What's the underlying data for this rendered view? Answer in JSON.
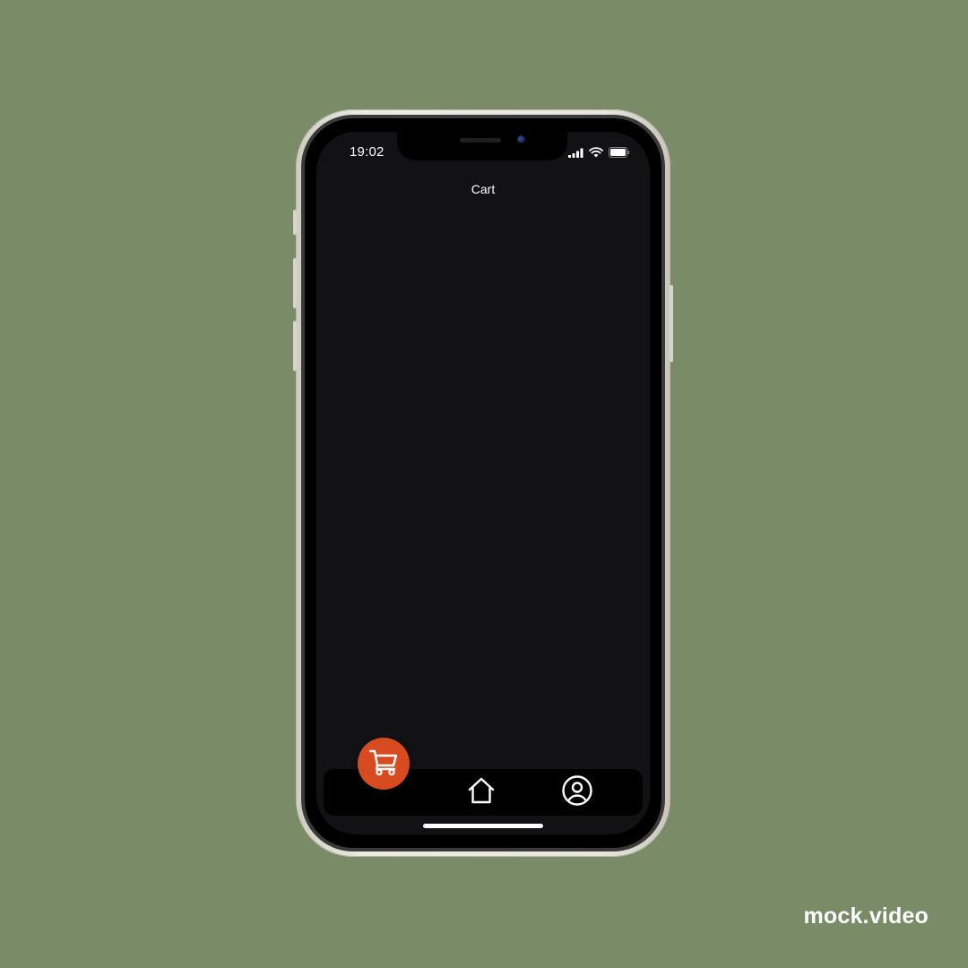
{
  "status_bar": {
    "time": "19:02",
    "icons": [
      "cellular-signal-icon",
      "wifi-icon",
      "battery-icon"
    ]
  },
  "screen": {
    "title": "Cart"
  },
  "cart_button": {
    "icon": "cart-icon",
    "color": "#d84b20"
  },
  "bottom_nav": {
    "items": [
      {
        "icon": "home-icon"
      },
      {
        "icon": "profile-icon"
      }
    ]
  },
  "watermark": "mock.video",
  "colors": {
    "background": "#7a8b67",
    "screen": "#121214",
    "accent": "#d84b20"
  }
}
